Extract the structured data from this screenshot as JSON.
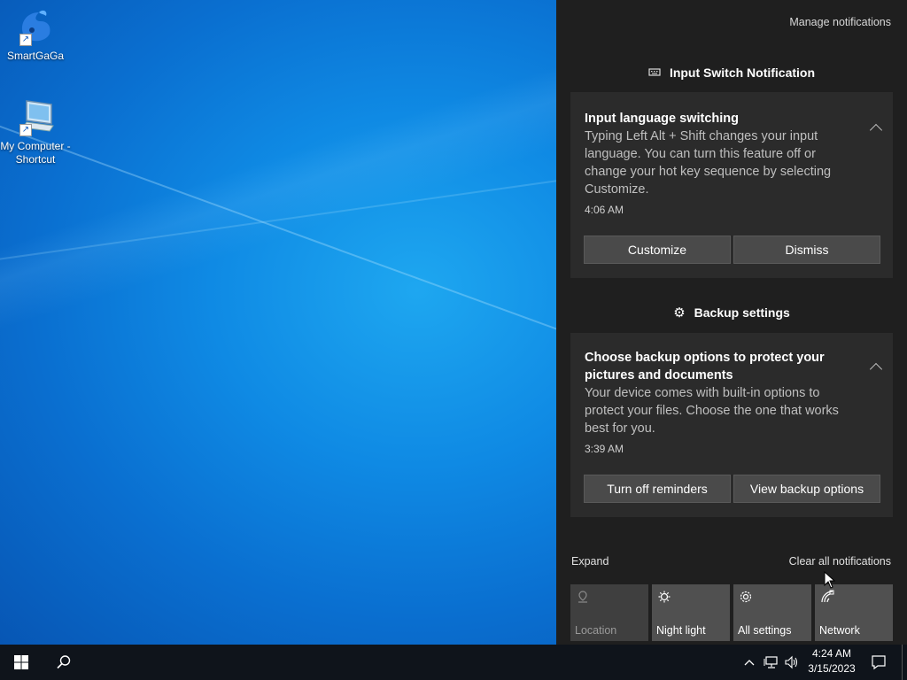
{
  "desktop": {
    "icons": [
      {
        "label": "SmartGaGa"
      },
      {
        "label": "My Computer - Shortcut"
      }
    ]
  },
  "action_center": {
    "manage_label": "Manage notifications",
    "groups": [
      {
        "title": "Input Switch Notification",
        "notification": {
          "title": "Input language switching",
          "body": "Typing Left Alt + Shift changes your input language. You can turn this feature off or change your hot key sequence by selecting Customize.",
          "time": "4:06 AM",
          "buttons": [
            "Customize",
            "Dismiss"
          ]
        }
      },
      {
        "title": "Backup settings",
        "notification": {
          "title": "Choose backup options to protect your pictures and documents",
          "body": "Your device comes with built-in options to protect your files. Choose the one that works best for you.",
          "time": "3:39 AM",
          "buttons": [
            "Turn off reminders",
            "View backup options"
          ]
        }
      }
    ],
    "expand_label": "Expand",
    "clear_label": "Clear all notifications",
    "quick_actions": [
      {
        "label": "Location",
        "icon": "location-icon",
        "enabled": false
      },
      {
        "label": "Night light",
        "icon": "night-light-icon",
        "enabled": true
      },
      {
        "label": "All settings",
        "icon": "gear-icon",
        "enabled": true
      },
      {
        "label": "Network",
        "icon": "network-icon",
        "enabled": true
      }
    ]
  },
  "taskbar": {
    "time": "4:24 AM",
    "date": "3/15/2023"
  },
  "colors": {
    "panel_bg": "#1f1f1f",
    "card_bg": "#2b2b2b",
    "button_bg": "#4a4a4a",
    "tile_bg": "#505050",
    "taskbar_bg": "#0f141b",
    "desktop_blue": "#0f8ae4"
  }
}
